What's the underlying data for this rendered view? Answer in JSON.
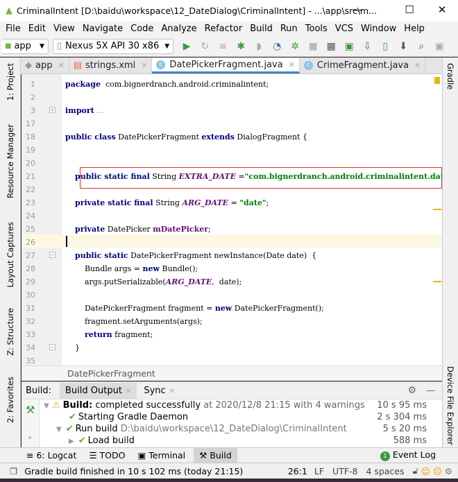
{
  "window": {
    "title": "CriminalIntent [D:\\baidu\\workspace\\12_DateDialog\\CriminalIntent] - ...\\app\\src\\m...",
    "minimize": "—",
    "maximize": "☐",
    "close": "✕"
  },
  "menu": [
    "File",
    "Edit",
    "View",
    "Navigate",
    "Code",
    "Analyze",
    "Refactor",
    "Build",
    "Run",
    "Tools",
    "VCS",
    "Window",
    "Help"
  ],
  "toolbar": {
    "module": "app",
    "device": "Nexus 5X API 30 x86"
  },
  "tabs": [
    {
      "label": "app",
      "active": false
    },
    {
      "label": "strings.xml",
      "active": false
    },
    {
      "label": "DatePickerFragment.java",
      "active": true
    },
    {
      "label": "CrimeFragment.java",
      "active": false
    }
  ],
  "left_strip": [
    "1: Project",
    "Resource Manager",
    "Layout Captures",
    "Z: Structure",
    "2: Favorites"
  ],
  "right_strip": [
    "Gradle",
    "Device File Explorer"
  ],
  "code": [
    {
      "n": "1",
      "tokens": [
        [
          "kw",
          "package"
        ],
        [
          "",
          "  com.bignerdranch.android.criminalintent;"
        ]
      ]
    },
    {
      "n": "2",
      "tokens": []
    },
    {
      "n": "3",
      "tokens": [
        [
          "kw",
          "import"
        ],
        [
          "dim",
          " ..."
        ]
      ]
    },
    {
      "n": "17",
      "tokens": []
    },
    {
      "n": "18",
      "tokens": [
        [
          "kw",
          "public class"
        ],
        [
          "",
          " DatePickerFragment "
        ],
        [
          "kw",
          "extends"
        ],
        [
          "",
          " DialogFragment {"
        ]
      ]
    },
    {
      "n": "19",
      "tokens": []
    },
    {
      "n": "20",
      "tokens": []
    },
    {
      "n": "21",
      "tokens": [
        [
          "",
          "    "
        ],
        [
          "kw",
          "public static final"
        ],
        [
          "",
          " String "
        ],
        [
          "cst",
          "EXTRA_DATE"
        ],
        [
          "",
          " ="
        ],
        [
          "str",
          "\"com.bignerdranch.android.criminalintent.date\""
        ],
        [
          "",
          ";"
        ]
      ]
    },
    {
      "n": "22",
      "tokens": []
    },
    {
      "n": "23",
      "tokens": [
        [
          "",
          "    "
        ],
        [
          "kw",
          "private static final"
        ],
        [
          "",
          " String "
        ],
        [
          "cst",
          "ARG_DATE"
        ],
        [
          "",
          " = "
        ],
        [
          "str",
          "\"date\""
        ],
        [
          "",
          ";"
        ]
      ]
    },
    {
      "n": "24",
      "tokens": []
    },
    {
      "n": "25",
      "tokens": [
        [
          "",
          "    "
        ],
        [
          "kw",
          "private"
        ],
        [
          "",
          " DatePicker "
        ],
        [
          "fld",
          "mDatePicker"
        ],
        [
          "",
          ";"
        ]
      ]
    },
    {
      "n": "26",
      "tokens": []
    },
    {
      "n": "27",
      "tokens": [
        [
          "",
          "    "
        ],
        [
          "kw",
          "public static"
        ],
        [
          "",
          " DatePickerFragment newInstance(Date date)  {"
        ]
      ]
    },
    {
      "n": "28",
      "tokens": [
        [
          "",
          "        Bundle args = "
        ],
        [
          "kw",
          "new"
        ],
        [
          "",
          " Bundle();"
        ]
      ]
    },
    {
      "n": "29",
      "tokens": [
        [
          "",
          "        args.putSerializable("
        ],
        [
          "cst",
          "ARG_DATE"
        ],
        [
          "",
          ",  date);"
        ]
      ]
    },
    {
      "n": "30",
      "tokens": []
    },
    {
      "n": "31",
      "tokens": [
        [
          "",
          "        DatePickerFragment fragment = "
        ],
        [
          "kw",
          "new"
        ],
        [
          "",
          " DatePickerFragment();"
        ]
      ]
    },
    {
      "n": "32",
      "tokens": [
        [
          "",
          "        fragment.setArguments(args);"
        ]
      ]
    },
    {
      "n": "33",
      "tokens": [
        [
          "",
          "        "
        ],
        [
          "kw",
          "return"
        ],
        [
          "",
          " fragment;"
        ]
      ]
    },
    {
      "n": "34",
      "tokens": [
        [
          "",
          "    }"
        ]
      ]
    },
    {
      "n": "35",
      "tokens": []
    }
  ],
  "breadcrumb": "DatePickerFragment",
  "build": {
    "label": "Build:",
    "tabs": [
      "Build Output",
      "Sync"
    ],
    "rows": [
      {
        "bold": "Build:",
        "text": " completed successfully",
        "meta": " at 2020/12/8 21:15  with 4 warnings",
        "dur": "10 s 95 ms"
      },
      {
        "text": "Starting Gradle Daemon",
        "dur": "2 s 304 ms"
      },
      {
        "text": "Run build",
        "meta": " D:\\baidu\\workspace\\12_DateDialog\\CriminalIntent",
        "dur": "5 s 20 ms"
      },
      {
        "text": "Load build",
        "dur": "588 ms"
      }
    ]
  },
  "bottom_tabs": [
    "6: Logcat",
    "TODO",
    "Terminal",
    "Build"
  ],
  "event_log": "Event Log",
  "event_count": "1",
  "status": {
    "message": "Gradle build finished in 10 s 102 ms (today 21:15)",
    "position": "26:1",
    "line_sep": "LF",
    "encoding": "UTF-8",
    "indent": "4 spaces"
  }
}
